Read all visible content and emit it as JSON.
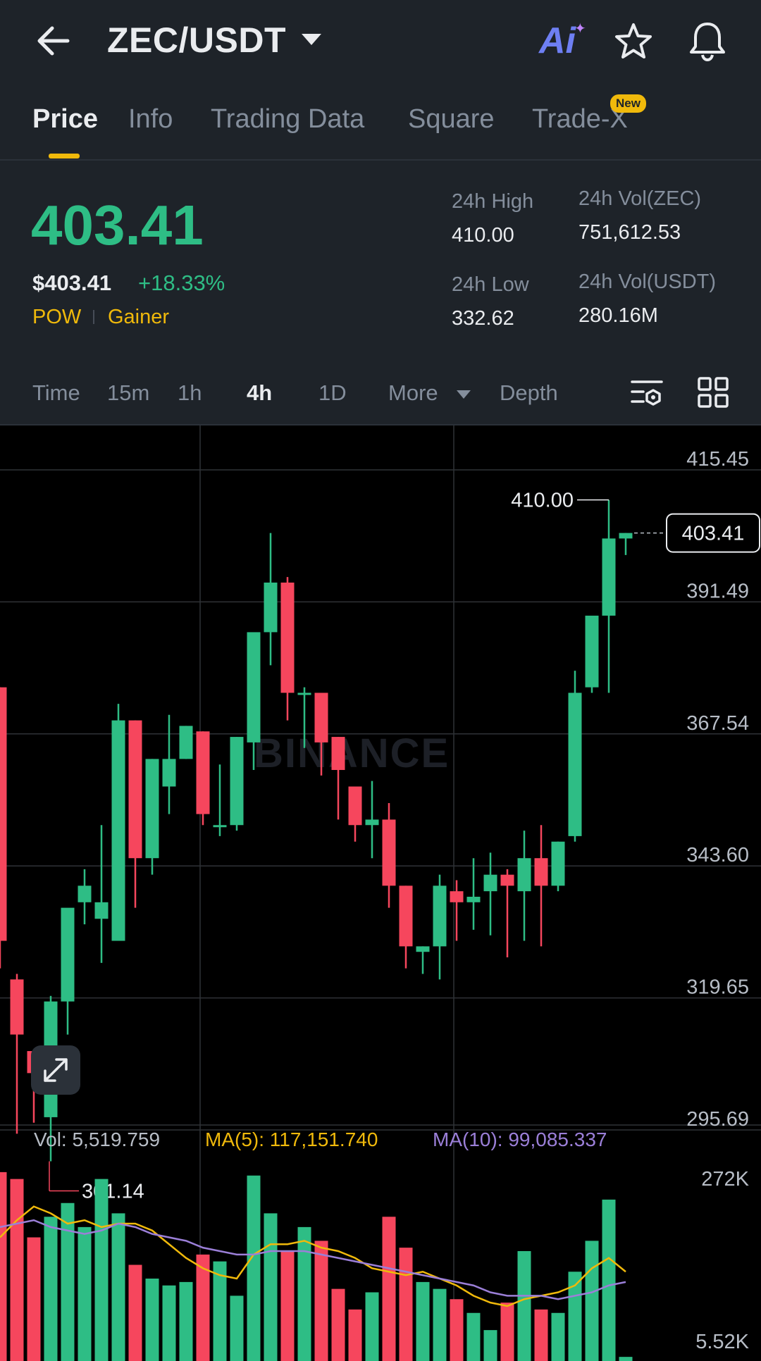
{
  "header": {
    "back_icon": "arrow-left-icon",
    "pair": "ZEC/USDT",
    "ai_label": "Ai",
    "ai_spark": "✦",
    "favorite_icon": "star-icon",
    "alert_icon": "bell-icon"
  },
  "tabs": [
    {
      "label": "Price",
      "active": true
    },
    {
      "label": "Info"
    },
    {
      "label": "Trading Data"
    },
    {
      "label": "Square"
    },
    {
      "label": "Trade-X",
      "badge": "New"
    }
  ],
  "ticker": {
    "last_price": "403.41",
    "usd_price": "$403.41",
    "change_pct": "+18.33%",
    "tags": [
      "POW",
      "Gainer"
    ],
    "high_label": "24h High",
    "high": "410.00",
    "low_label": "24h Low",
    "low": "332.62",
    "vol_base_label": "24h Vol(ZEC)",
    "vol_base": "751,612.53",
    "vol_quote_label": "24h Vol(USDT)",
    "vol_quote": "280.16M"
  },
  "timeframes": {
    "items": [
      "Time",
      "15m",
      "1h",
      "4h",
      "1D",
      "More",
      "Depth"
    ],
    "selected": "4h",
    "indicator_icon": "chart-settings-icon",
    "layout_icon": "grid-layout-icon"
  },
  "colors": {
    "up": "#2ebd85",
    "down": "#f6465d",
    "accent": "#f0b90b",
    "ma5": "#f0b90b",
    "ma10": "#9b7fd8"
  },
  "chart_data": {
    "type": "candlestick",
    "watermark": "BINANCE",
    "price_axis": [
      "415.45",
      "391.49",
      "367.54",
      "343.60",
      "319.65",
      "295.69"
    ],
    "ylim": [
      295.69,
      415.45
    ],
    "high_marker": "410.00",
    "low_marker": "301.14",
    "current_price_label": "403.41",
    "candles": [
      {
        "o": 376,
        "h": 376,
        "l": 325,
        "c": 330
      },
      {
        "o": 323,
        "h": 324,
        "l": 295,
        "c": 313
      },
      {
        "o": 310,
        "h": 310,
        "l": 297,
        "c": 306
      },
      {
        "o": 298,
        "h": 320,
        "l": 290,
        "c": 319
      },
      {
        "o": 319,
        "h": 335,
        "l": 313,
        "c": 336
      },
      {
        "o": 337,
        "h": 343,
        "l": 333,
        "c": 340
      },
      {
        "o": 334,
        "h": 351,
        "l": 326,
        "c": 337
      },
      {
        "o": 330,
        "h": 373,
        "l": 330,
        "c": 370
      },
      {
        "o": 370,
        "h": 370,
        "l": 336,
        "c": 345
      },
      {
        "o": 345,
        "h": 363,
        "l": 342,
        "c": 363
      },
      {
        "o": 358,
        "h": 371,
        "l": 353,
        "c": 363
      },
      {
        "o": 363,
        "h": 369,
        "l": 363,
        "c": 369
      },
      {
        "o": 368,
        "h": 368,
        "l": 351,
        "c": 353
      },
      {
        "o": 351,
        "h": 362,
        "l": 349,
        "c": 351
      },
      {
        "o": 351,
        "h": 367,
        "l": 350,
        "c": 367
      },
      {
        "o": 366,
        "h": 385,
        "l": 361,
        "c": 386
      },
      {
        "o": 386,
        "h": 404,
        "l": 380,
        "c": 395
      },
      {
        "o": 395,
        "h": 396,
        "l": 370,
        "c": 375
      },
      {
        "o": 375,
        "h": 376,
        "l": 365,
        "c": 375
      },
      {
        "o": 375,
        "h": 375,
        "l": 360,
        "c": 366
      },
      {
        "o": 367,
        "h": 367,
        "l": 352,
        "c": 361
      },
      {
        "o": 358,
        "h": 358,
        "l": 348,
        "c": 351
      },
      {
        "o": 351,
        "h": 359,
        "l": 345,
        "c": 352
      },
      {
        "o": 352,
        "h": 355,
        "l": 336,
        "c": 340
      },
      {
        "o": 340,
        "h": 340,
        "l": 325,
        "c": 329
      },
      {
        "o": 328,
        "h": 329,
        "l": 324,
        "c": 329
      },
      {
        "o": 329,
        "h": 342,
        "l": 323,
        "c": 340
      },
      {
        "o": 339,
        "h": 341,
        "l": 330,
        "c": 337
      },
      {
        "o": 337,
        "h": 345,
        "l": 332,
        "c": 338
      },
      {
        "o": 339,
        "h": 346,
        "l": 331,
        "c": 342
      },
      {
        "o": 342,
        "h": 343,
        "l": 327,
        "c": 340
      },
      {
        "o": 339,
        "h": 350,
        "l": 330,
        "c": 345
      },
      {
        "o": 345,
        "h": 351,
        "l": 329,
        "c": 340
      },
      {
        "o": 340,
        "h": 348,
        "l": 339,
        "c": 348
      },
      {
        "o": 349,
        "h": 379,
        "l": 348,
        "c": 375
      },
      {
        "o": 376,
        "h": 386,
        "l": 375,
        "c": 389
      },
      {
        "o": 389,
        "h": 410,
        "l": 375,
        "c": 403
      },
      {
        "o": 403,
        "h": 404,
        "l": 400,
        "c": 404
      }
    ],
    "volume_legend": {
      "vol": "Vol: 5,519.759",
      "ma5": "MA(5): 117,151.740",
      "ma10": "MA(10): 99,085.337"
    },
    "volume_axis": [
      "272K",
      "5.52K"
    ],
    "volume_ylim": [
      0,
      280000
    ],
    "volumes": [
      275000,
      265000,
      180000,
      210000,
      230000,
      195000,
      265000,
      215000,
      140000,
      120000,
      110000,
      115000,
      155000,
      145000,
      95000,
      270000,
      215000,
      160000,
      195000,
      175000,
      105000,
      75000,
      100000,
      210000,
      165000,
      115000,
      105000,
      90000,
      70000,
      45000,
      85000,
      160000,
      75000,
      70000,
      130000,
      175000,
      235000,
      6000
    ],
    "ma5_line": [
      180000,
      205000,
      225000,
      215000,
      200000,
      205000,
      195000,
      200000,
      200000,
      190000,
      170000,
      150000,
      135000,
      125000,
      120000,
      155000,
      170000,
      170000,
      175000,
      165000,
      160000,
      150000,
      135000,
      130000,
      125000,
      130000,
      120000,
      110000,
      95000,
      85000,
      80000,
      90000,
      95000,
      100000,
      110000,
      135000,
      150000,
      130000
    ],
    "ma10_line": [
      195000,
      200000,
      205000,
      195000,
      190000,
      185000,
      190000,
      200000,
      195000,
      185000,
      180000,
      175000,
      165000,
      160000,
      155000,
      155000,
      160000,
      160000,
      160000,
      155000,
      150000,
      145000,
      140000,
      135000,
      130000,
      125000,
      120000,
      115000,
      110000,
      100000,
      95000,
      95000,
      95000,
      90000,
      95000,
      100000,
      110000,
      115000
    ]
  }
}
